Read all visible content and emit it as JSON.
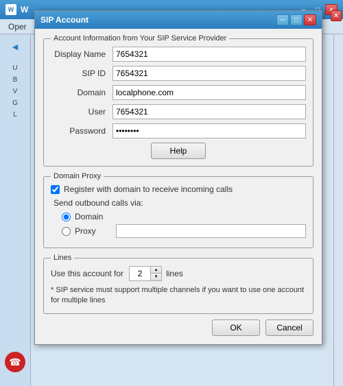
{
  "bgWindow": {
    "title": "W",
    "menuItems": [
      "Oper"
    ],
    "sidebarItems": [
      "U",
      "B",
      "V",
      "G",
      "L"
    ]
  },
  "dialog": {
    "title": "SIP Account",
    "sections": {
      "accountInfo": {
        "legend": "Account Information from Your SIP Service Provider",
        "fields": {
          "displayName": {
            "label": "Display Name",
            "value": "7654321"
          },
          "sipId": {
            "label": "SIP ID",
            "value": "7654321"
          },
          "domain": {
            "label": "Domain",
            "value": "localphone.com"
          },
          "user": {
            "label": "User",
            "value": "7654321"
          },
          "password": {
            "label": "Password",
            "value": "••••••••"
          }
        },
        "helpButton": "Help"
      },
      "domainProxy": {
        "legend": "Domain Proxy",
        "registerCheckboxLabel": "Register with domain to receive incoming calls",
        "sendLabel": "Send outbound calls via:",
        "radioOptions": {
          "domain": "Domain",
          "proxy": "Proxy"
        }
      },
      "lines": {
        "legend": "Lines",
        "useLabel": "Use this account for",
        "linesValue": "2",
        "linesSuffix": "lines",
        "note": "* SIP service must support multiple channels if you want to use one account for multiple lines"
      }
    },
    "buttons": {
      "ok": "OK",
      "cancel": "Cancel"
    }
  }
}
